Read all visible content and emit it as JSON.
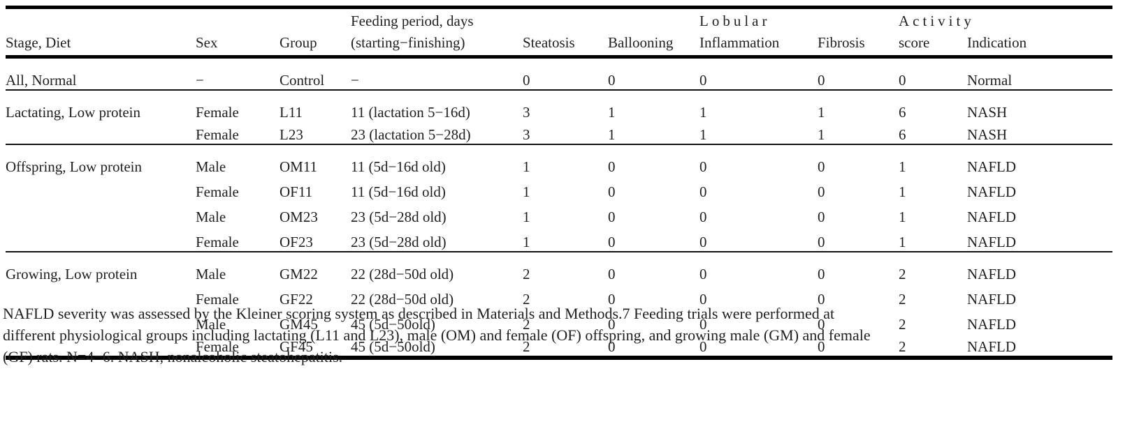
{
  "table": {
    "columns": [
      {
        "key": "stage",
        "upper": "",
        "lower": "Stage, Diet"
      },
      {
        "key": "sex",
        "upper": "",
        "lower": "Sex"
      },
      {
        "key": "group",
        "upper": "",
        "lower": "Group"
      },
      {
        "key": "period",
        "upper": "Feeding period, days",
        "lower": "(starting−finishing)"
      },
      {
        "key": "stea",
        "upper": "",
        "lower": "Steatosis"
      },
      {
        "key": "ball",
        "upper": "",
        "lower": "Ballooning"
      },
      {
        "key": "infl",
        "upper": "Lobular",
        "lower": "Inflammation"
      },
      {
        "key": "fibr",
        "upper": "",
        "lower": "Fibrosis"
      },
      {
        "key": "act",
        "upper": "Activity",
        "lower": "score"
      },
      {
        "key": "ind",
        "upper": "",
        "lower": "Indication"
      }
    ],
    "rows": [
      {
        "stage": "All, Normal",
        "sex": "−",
        "group": "Control",
        "period": "−",
        "stea": "0",
        "ball": "0",
        "infl": "0",
        "fibr": "0",
        "act": "0",
        "ind": "Normal"
      },
      {
        "stage": "Lactating, Low protein",
        "sex": "Female",
        "group": "L11",
        "period": "11 (lactation 5−16d)",
        "stea": "3",
        "ball": "1",
        "infl": "1",
        "fibr": "1",
        "act": "6",
        "ind": "NASH"
      },
      {
        "stage": "",
        "sex": "Female",
        "group": "L23",
        "period": "23 (lactation 5−28d)",
        "stea": "3",
        "ball": "1",
        "infl": "1",
        "fibr": "1",
        "act": "6",
        "ind": "NASH"
      },
      {
        "stage": "Offspring, Low protein",
        "sex": "Male",
        "group": "OM11",
        "period": "11 (5d−16d old)",
        "stea": "1",
        "ball": "0",
        "infl": "0",
        "fibr": "0",
        "act": "1",
        "ind": "NAFLD"
      },
      {
        "stage": "",
        "sex": "Female",
        "group": "OF11",
        "period": "11 (5d−16d old)",
        "stea": "1",
        "ball": "0",
        "infl": "0",
        "fibr": "0",
        "act": "1",
        "ind": "NAFLD"
      },
      {
        "stage": "",
        "sex": "Male",
        "group": "OM23",
        "period": "23 (5d−28d old)",
        "stea": "1",
        "ball": "0",
        "infl": "0",
        "fibr": "0",
        "act": "1",
        "ind": "NAFLD"
      },
      {
        "stage": "",
        "sex": "Female",
        "group": "OF23",
        "period": "23 (5d−28d old)",
        "stea": "1",
        "ball": "0",
        "infl": "0",
        "fibr": "0",
        "act": "1",
        "ind": "NAFLD"
      },
      {
        "stage": "Growing, Low protein",
        "sex": "Male",
        "group": "GM22",
        "period": "22 (28d−50d old)",
        "stea": "2",
        "ball": "0",
        "infl": "0",
        "fibr": "0",
        "act": "2",
        "ind": "NAFLD"
      },
      {
        "stage": "",
        "sex": "Female",
        "group": "GF22",
        "period": "22 (28d−50d old)",
        "stea": "2",
        "ball": "0",
        "infl": "0",
        "fibr": "0",
        "act": "2",
        "ind": "NAFLD"
      },
      {
        "stage": "",
        "sex": "Male",
        "group": "GM45",
        "period": "45 (5d−50old)",
        "stea": "2",
        "ball": "0",
        "infl": "0",
        "fibr": "0",
        "act": "2",
        "ind": "NAFLD"
      },
      {
        "stage": "",
        "sex": "Female",
        "group": "GF45",
        "period": "45 (5d−50old)",
        "stea": "2",
        "ball": "0",
        "infl": "0",
        "fibr": "0",
        "act": "2",
        "ind": "NAFLD"
      }
    ]
  },
  "caption": {
    "line1": "NAFLD severity was assessed by the Kleiner scoring system as described in Materials and Methods.7 Feeding trials were performed at",
    "line2": "different physiological groups including lactating (L11 and L23), male (OM) and female (OF) offspring, and growing male (GM) and female",
    "line3": "(GF) rats. N=4−6. NASH, nonalcoholic steatohepatitis."
  }
}
